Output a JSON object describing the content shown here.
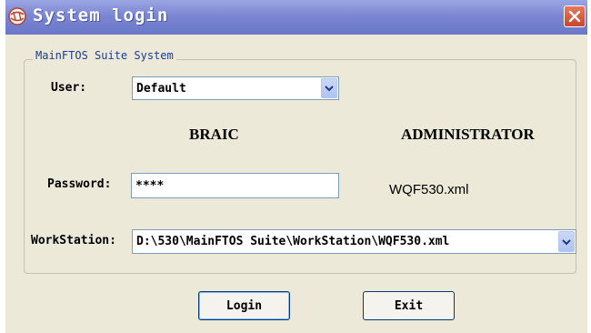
{
  "window": {
    "title": "System login",
    "icon": "app-globe-icon",
    "close_icon": "close-icon"
  },
  "group": {
    "legend": "MainFTOS Suite System"
  },
  "form": {
    "user_label": "User:",
    "user_value": "Default",
    "password_label": "Password:",
    "password_value": "****",
    "workstation_label": "WorkStation:",
    "workstation_value": "D:\\530\\MainFTOS Suite\\WorkStation\\WQF530.xml"
  },
  "info": {
    "left_heading": "BRAIC",
    "right_heading": "ADMINISTRATOR",
    "config_file": "WQF530.xml"
  },
  "buttons": {
    "login": "Login",
    "exit": "Exit"
  },
  "colors": {
    "titlebar": "#7b86d2",
    "window_bg": "#ece9d8",
    "close": "#d5573b",
    "legend_text": "#1b3c9a"
  }
}
